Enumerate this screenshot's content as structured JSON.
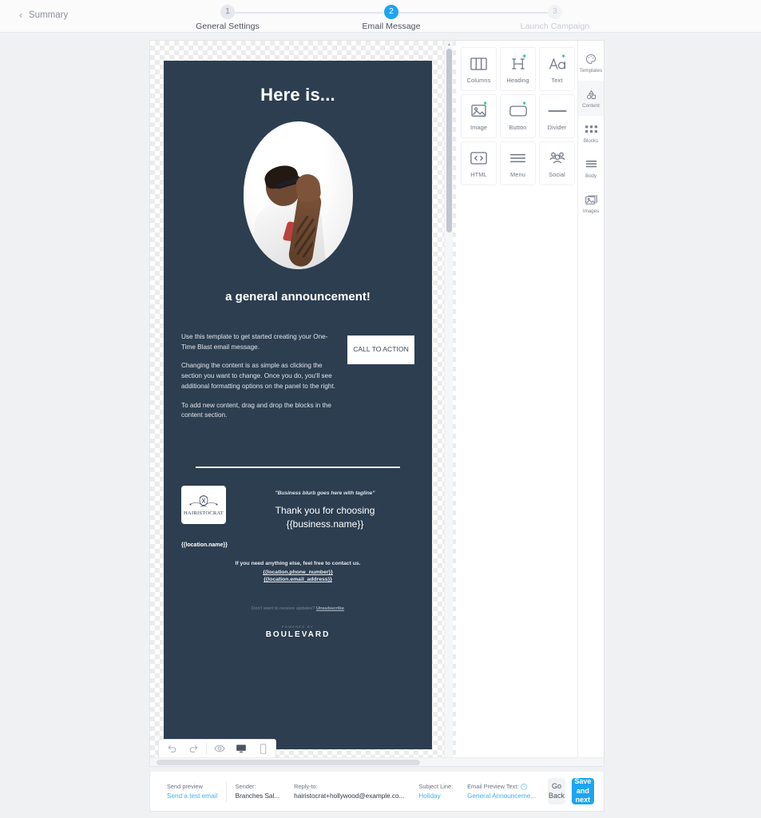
{
  "header": {
    "back_label": "Summary",
    "steps": [
      {
        "num": "1",
        "label": "General Settings",
        "state": "complete"
      },
      {
        "num": "2",
        "label": "Email Message",
        "state": "active"
      },
      {
        "num": "3",
        "label": "Launch Campaign",
        "state": "future"
      }
    ]
  },
  "email": {
    "heading": "Here is...",
    "subheading": "a general announcement!",
    "paragraphs": [
      "Use this template to get started creating your One-Time Blast email message.",
      "Changing the content is as simple as clicking the section you want to change. Once you do, you'll see additional formatting options on the panel to the right.",
      "To add new content, drag and drop the blocks in the content section."
    ],
    "cta_label": "CALL TO ACTION",
    "logo_word": "HAIRISTOCRAT",
    "blurb": "\"Business blurb goes here with tagline\"",
    "thanks_line1": "Thank you for choosing",
    "thanks_line2": "{{business.name}}",
    "location_name": "{{location.name}}",
    "contact_line": "If you need anything else, feel free to contact us.",
    "contact_phone": "{{location.phone_number}}",
    "contact_email": "{{location.email_address}}",
    "unsubscribe_text": "Don't want to receive updates?",
    "unsubscribe_link": "Unsubscribe",
    "powered_small": "POWERED BY",
    "powered_word": "BOULEVARD",
    "background_color": "#2b3b4e"
  },
  "mini_toolbar": {
    "items": [
      {
        "name": "undo",
        "icon": "undo-icon",
        "state": "disabled"
      },
      {
        "name": "redo",
        "icon": "redo-icon",
        "state": "disabled"
      },
      {
        "name": "preview",
        "icon": "eye-icon",
        "state": "enabled"
      },
      {
        "name": "desktop",
        "icon": "desktop-icon",
        "state": "active"
      },
      {
        "name": "mobile",
        "icon": "mobile-icon",
        "state": "enabled"
      }
    ]
  },
  "blocks_panel": {
    "tiles": [
      {
        "label": "Columns",
        "icon": "columns-icon",
        "ai": false
      },
      {
        "label": "Heading",
        "icon": "heading-icon",
        "ai": true
      },
      {
        "label": "Text",
        "icon": "text-icon",
        "ai": true
      },
      {
        "label": "Image",
        "icon": "image-icon",
        "ai": true
      },
      {
        "label": "Button",
        "icon": "button-icon",
        "ai": true
      },
      {
        "label": "Divider",
        "icon": "divider-icon",
        "ai": false
      },
      {
        "label": "HTML",
        "icon": "html-icon",
        "ai": false
      },
      {
        "label": "Menu",
        "icon": "menu-icon",
        "ai": false
      },
      {
        "label": "Social",
        "icon": "social-icon",
        "ai": false
      }
    ],
    "ai_accent_color": "#1ec98a"
  },
  "rail": {
    "items": [
      {
        "label": "Templates",
        "icon": "palette-icon",
        "active": false
      },
      {
        "label": "Content",
        "icon": "shapes-icon",
        "active": true
      },
      {
        "label": "Blocks",
        "icon": "grid-dots-icon",
        "active": false
      },
      {
        "label": "Body",
        "icon": "lines-icon",
        "active": false
      },
      {
        "label": "Images",
        "icon": "photos-icon",
        "active": false
      }
    ]
  },
  "bottom_bar": {
    "send_preview_label": "Send preview",
    "send_preview_link": "Send a test email",
    "sender_label": "Sender:",
    "sender_value": "Branches Sal...",
    "reply_to_label": "Reply-to:",
    "reply_to_value": "hairistocrat+hollywood@example.co...",
    "subject_label": "Subject Line:",
    "subject_value": "Holiday",
    "preview_text_label": "Email Preview Text:",
    "preview_text_value": "General Announceme...",
    "go_back_label": "Go Back",
    "save_next_label": "Save and next",
    "primary_color": "#1ca5f0"
  }
}
